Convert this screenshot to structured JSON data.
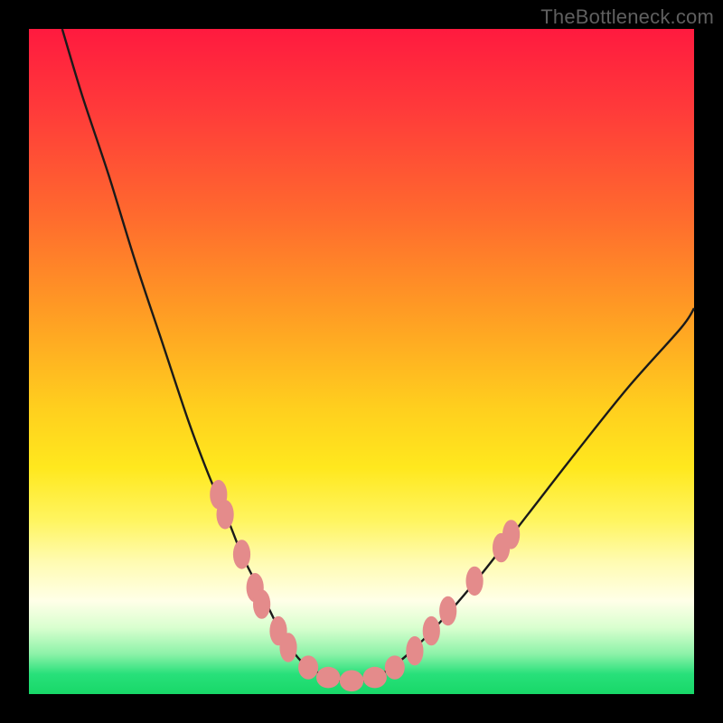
{
  "watermark": "TheBottleneck.com",
  "colors": {
    "frame": "#000000",
    "curve_stroke": "#1a1a1a",
    "marker_fill": "#e48b8b",
    "marker_stroke": "#d87777"
  },
  "chart_data": {
    "type": "line",
    "title": "",
    "xlabel": "",
    "ylabel": "",
    "xlim": [
      0,
      100
    ],
    "ylim": [
      0,
      100
    ],
    "legend": null,
    "grid": false,
    "series": [
      {
        "name": "bottleneck-curve",
        "x": [
          5,
          8,
          12,
          16,
          20,
          24,
          27,
          30,
          32,
          34,
          36,
          38,
          40,
          42,
          44,
          47,
          50,
          53,
          57,
          62,
          68,
          75,
          82,
          90,
          98,
          100
        ],
        "y": [
          100,
          90,
          78,
          65,
          53,
          41,
          33,
          26,
          21,
          17,
          13,
          9,
          6,
          4,
          3,
          2,
          2,
          3,
          6,
          11,
          18,
          27,
          36,
          46,
          55,
          58
        ]
      }
    ],
    "markers": [
      {
        "x": 28.5,
        "y": 30,
        "rx": 1.3,
        "ry": 2.2
      },
      {
        "x": 29.5,
        "y": 27,
        "rx": 1.3,
        "ry": 2.2
      },
      {
        "x": 32.0,
        "y": 21,
        "rx": 1.3,
        "ry": 2.2
      },
      {
        "x": 34.0,
        "y": 16,
        "rx": 1.3,
        "ry": 2.2
      },
      {
        "x": 35.0,
        "y": 13.5,
        "rx": 1.3,
        "ry": 2.2
      },
      {
        "x": 37.5,
        "y": 9.5,
        "rx": 1.3,
        "ry": 2.2
      },
      {
        "x": 39.0,
        "y": 7,
        "rx": 1.3,
        "ry": 2.2
      },
      {
        "x": 42.0,
        "y": 4,
        "rx": 1.5,
        "ry": 1.8
      },
      {
        "x": 45.0,
        "y": 2.5,
        "rx": 1.8,
        "ry": 1.6
      },
      {
        "x": 48.5,
        "y": 2,
        "rx": 1.8,
        "ry": 1.6
      },
      {
        "x": 52.0,
        "y": 2.5,
        "rx": 1.8,
        "ry": 1.6
      },
      {
        "x": 55.0,
        "y": 4,
        "rx": 1.5,
        "ry": 1.8
      },
      {
        "x": 58.0,
        "y": 6.5,
        "rx": 1.3,
        "ry": 2.2
      },
      {
        "x": 60.5,
        "y": 9.5,
        "rx": 1.3,
        "ry": 2.2
      },
      {
        "x": 63.0,
        "y": 12.5,
        "rx": 1.3,
        "ry": 2.2
      },
      {
        "x": 67.0,
        "y": 17,
        "rx": 1.3,
        "ry": 2.2
      },
      {
        "x": 71.0,
        "y": 22,
        "rx": 1.3,
        "ry": 2.2
      },
      {
        "x": 72.5,
        "y": 24,
        "rx": 1.3,
        "ry": 2.2
      }
    ]
  }
}
